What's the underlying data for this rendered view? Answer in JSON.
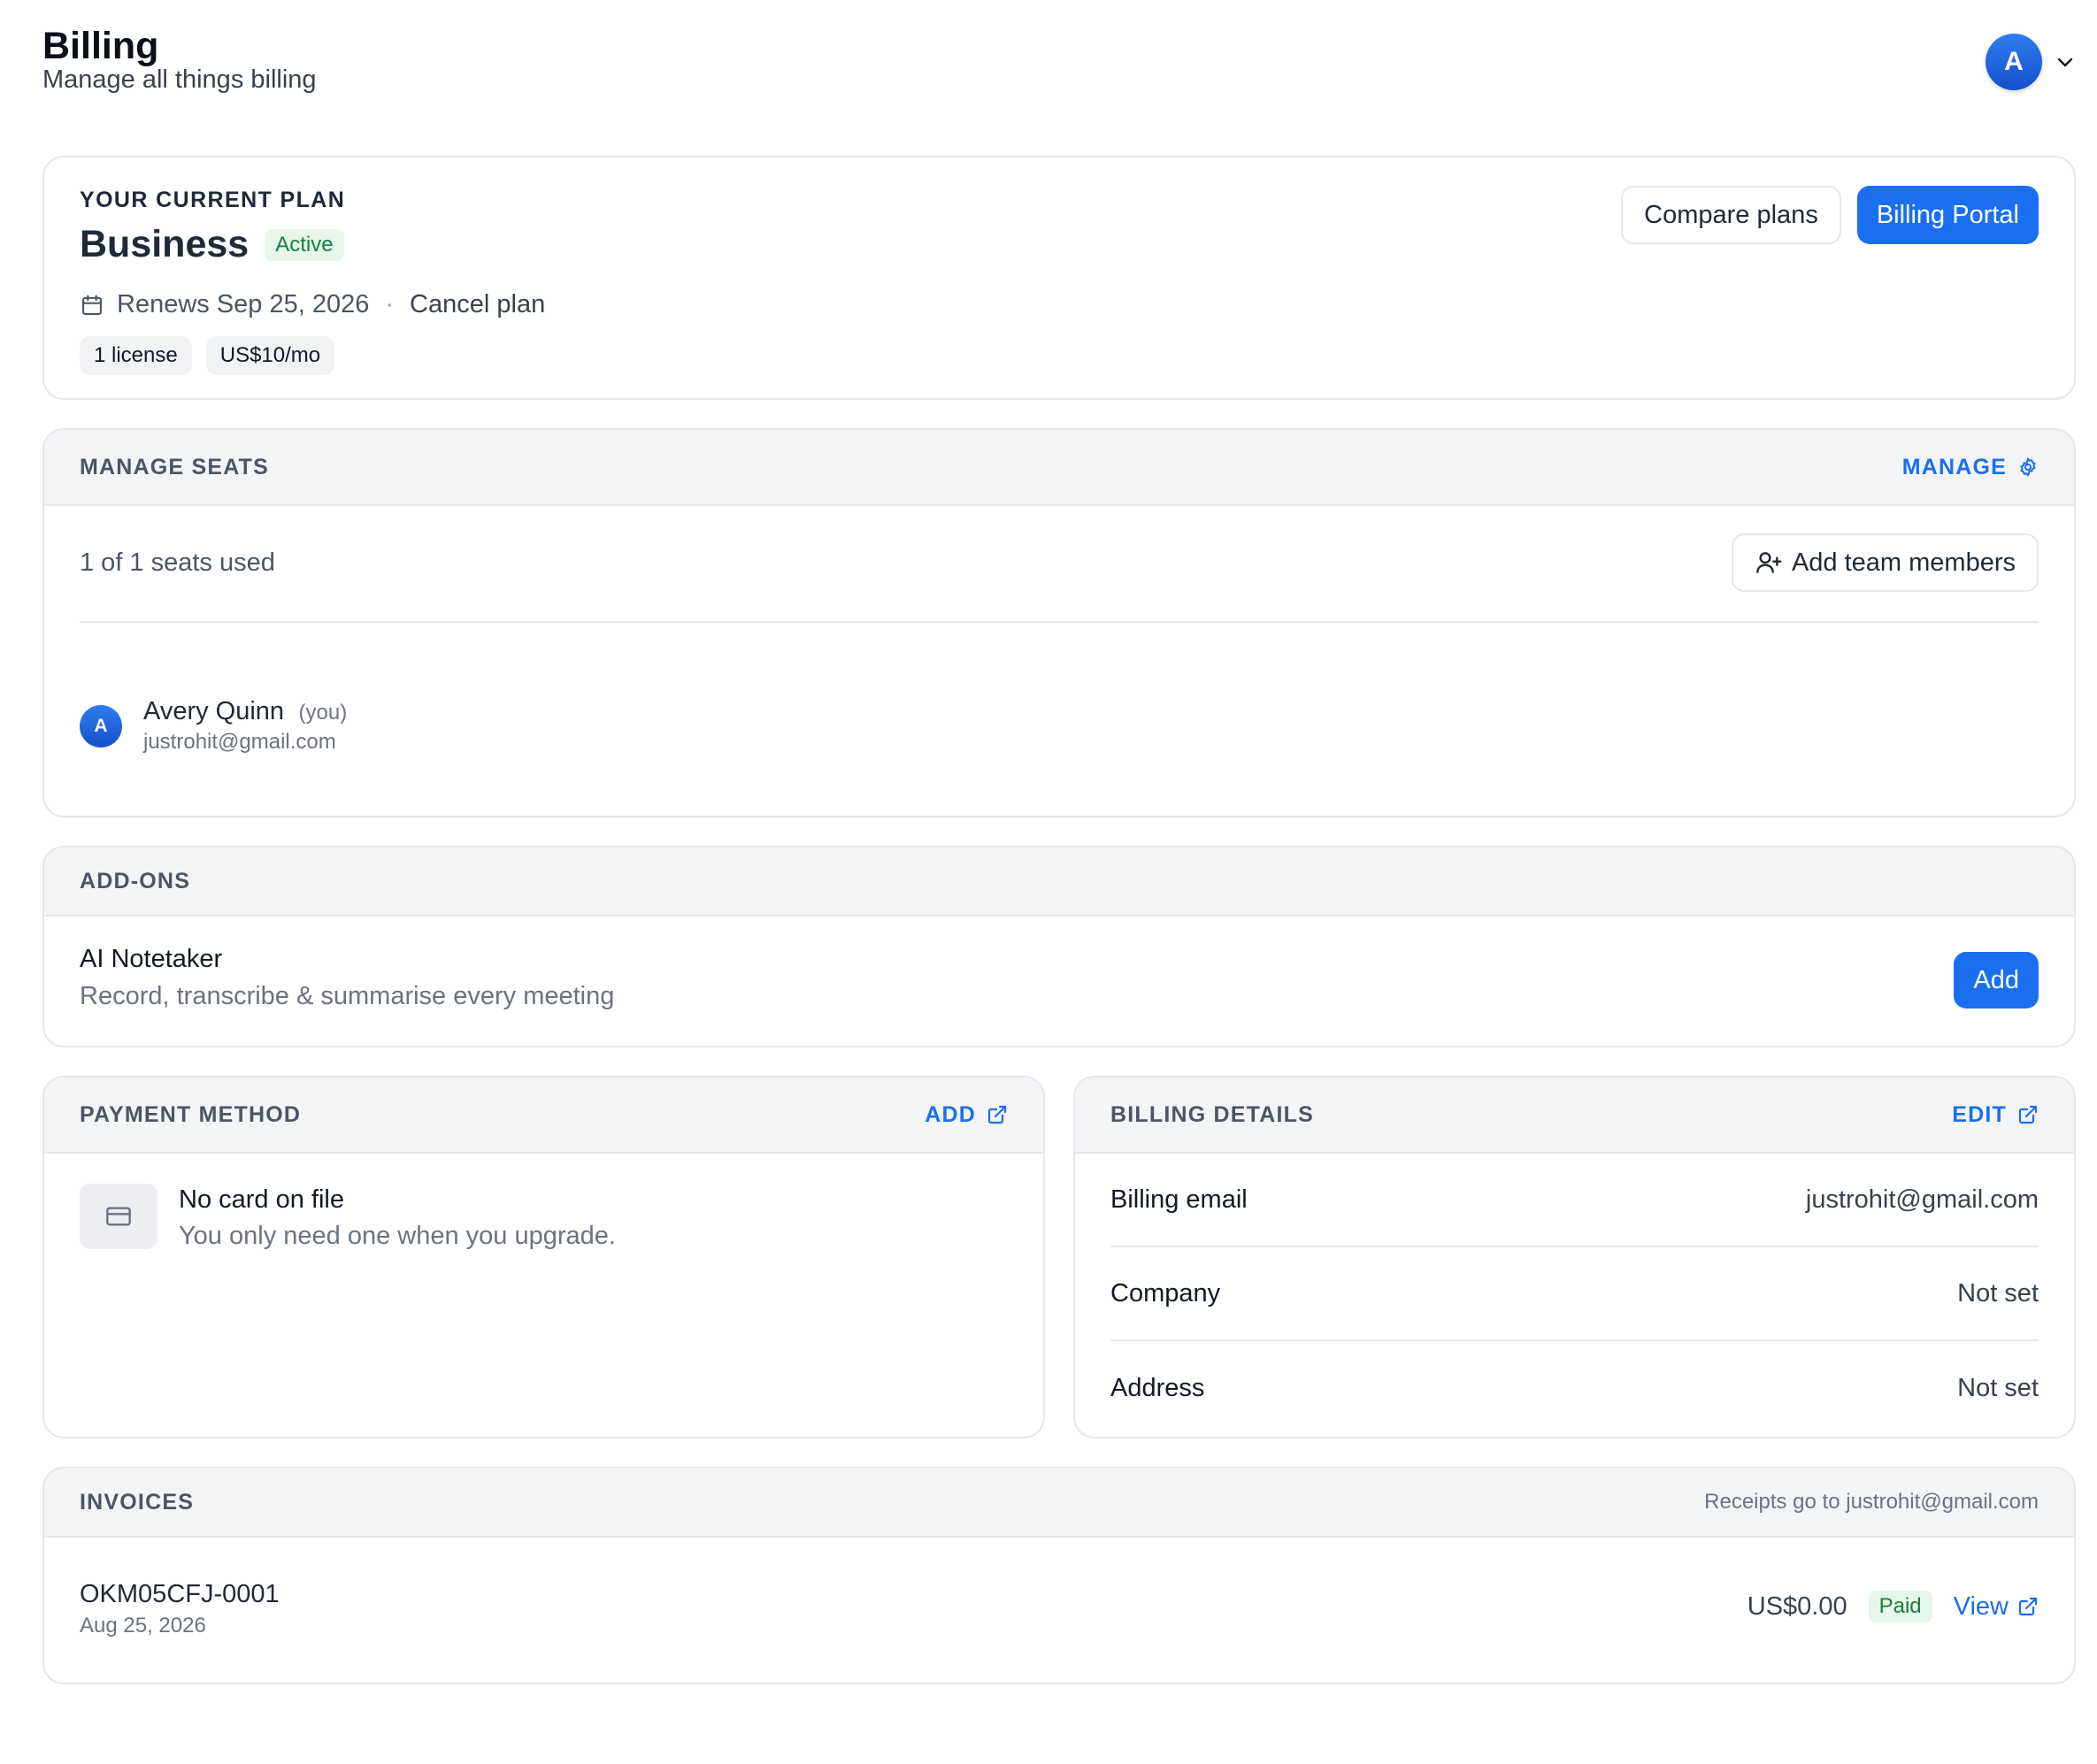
{
  "header": {
    "title": "Billing",
    "subtitle": "Manage all things billing",
    "avatar_initial": "A"
  },
  "plan": {
    "section_label": "YOUR CURRENT PLAN",
    "name": "Business",
    "status": "Active",
    "renews": "Renews Sep 25, 2026",
    "separator": "·",
    "cancel_label": "Cancel plan",
    "chips": [
      "1 license",
      "US$10/mo"
    ],
    "compare_label": "Compare plans",
    "portal_label": "Billing Portal"
  },
  "seats": {
    "section_label": "MANAGE SEATS",
    "manage_label": "MANAGE",
    "used_text": "1 of 1 seats used",
    "add_members_label": "Add team members",
    "member": {
      "initial": "A",
      "name": "Avery Quinn",
      "you_tag": "(you)",
      "email": "justrohit@gmail.com"
    }
  },
  "addons": {
    "section_label": "ADD-ONS",
    "item_name": "AI Notetaker",
    "item_desc": "Record, transcribe & summarise every meeting",
    "add_label": "Add"
  },
  "payment": {
    "section_label": "PAYMENT METHOD",
    "add_label": "ADD",
    "title": "No card on file",
    "subtitle": "You only need one when you upgrade."
  },
  "billing_details": {
    "section_label": "BILLING DETAILS",
    "edit_label": "EDIT",
    "rows": [
      {
        "key": "Billing email",
        "value": "justrohit@gmail.com"
      },
      {
        "key": "Company",
        "value": "Not set"
      },
      {
        "key": "Address",
        "value": "Not set"
      }
    ]
  },
  "invoices": {
    "section_label": "INVOICES",
    "note": "Receipts go to justrohit@gmail.com",
    "items": [
      {
        "id": "OKM05CFJ-0001",
        "date": "Aug 25, 2026",
        "amount": "US$0.00",
        "status": "Paid",
        "view_label": "View"
      }
    ]
  },
  "colors": {
    "accent": "#1a6ff0",
    "success_bg": "#e7f6ea",
    "success_text": "#15803d",
    "section_bg": "#f3f4f6"
  }
}
